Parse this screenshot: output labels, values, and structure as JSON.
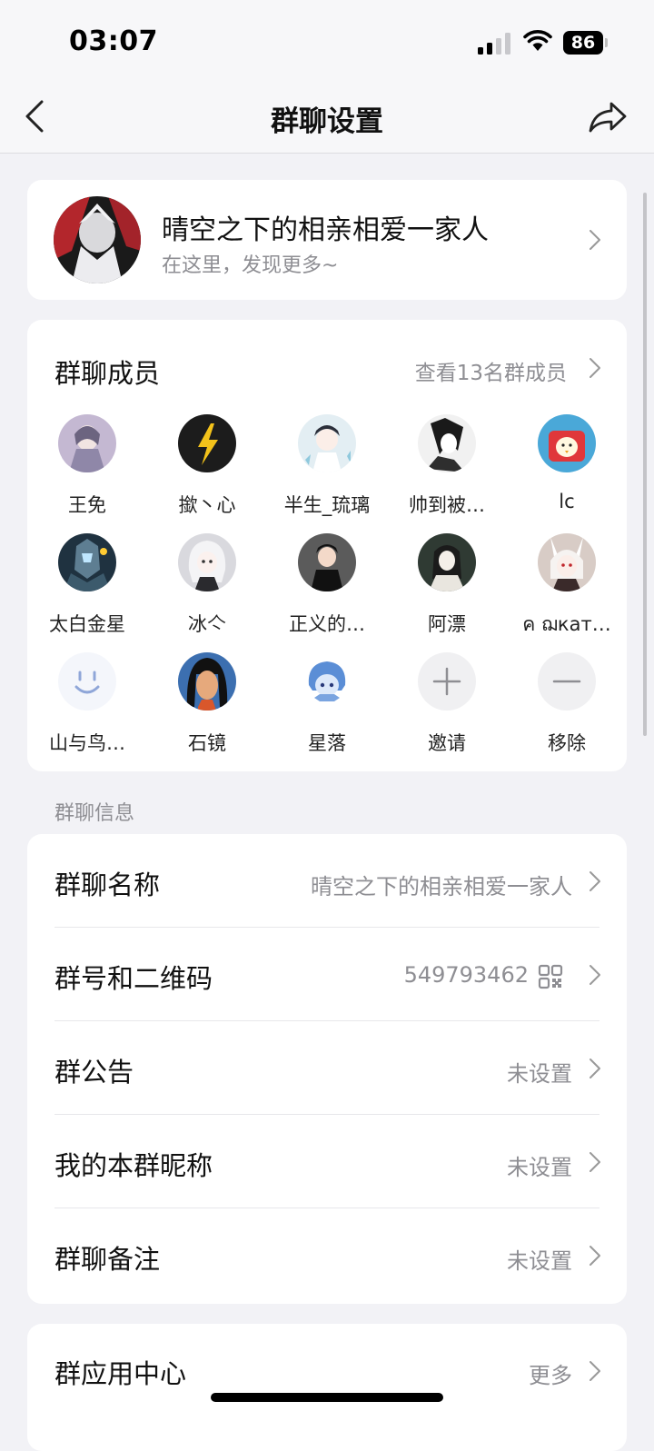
{
  "status_bar": {
    "time": "03:07",
    "battery": "86"
  },
  "nav": {
    "title": "群聊设置"
  },
  "group": {
    "name": "晴空之下的相亲相爱一家人",
    "subtitle": "在这里，发现更多~"
  },
  "members": {
    "title": "群聊成员",
    "view_all": "查看13名群成员",
    "list": [
      {
        "name": "王免",
        "color": "#b7a8c4"
      },
      {
        "name": "撳丶心",
        "color": "#1c1c1c"
      },
      {
        "name": "半生_琉璃",
        "color": "#d8e8ef"
      },
      {
        "name": "帅到被…",
        "color": "#d9d9d9"
      },
      {
        "name": "lc",
        "color": "#4aa8d8"
      },
      {
        "name": "太白金星",
        "color": "#2a4a5c"
      },
      {
        "name": "冰亽",
        "color": "#cfcfd4"
      },
      {
        "name": "正义的…",
        "color": "#5b5b5b"
      },
      {
        "name": "阿漂",
        "color": "#3d4a3f"
      },
      {
        "name": "ค ฌкат…",
        "color": "#cfc5c0"
      },
      {
        "name": "山与鸟…",
        "color": "#f4f6fb"
      },
      {
        "name": "石镜",
        "color": "#3a3e55"
      },
      {
        "name": "星落",
        "color": "#ffffff"
      }
    ],
    "invite_label": "邀请",
    "remove_label": "移除"
  },
  "info_section_label": "群聊信息",
  "info_rows": [
    {
      "label": "群聊名称",
      "value": "晴空之下的相亲相爱一家人"
    },
    {
      "label": "群号和二维码",
      "value": "549793462"
    },
    {
      "label": "群公告",
      "value": "未设置"
    },
    {
      "label": "我的本群昵称",
      "value": "未设置"
    },
    {
      "label": "群聊备注",
      "value": "未设置"
    }
  ],
  "apps": {
    "label": "群应用中心",
    "value": "更多"
  }
}
